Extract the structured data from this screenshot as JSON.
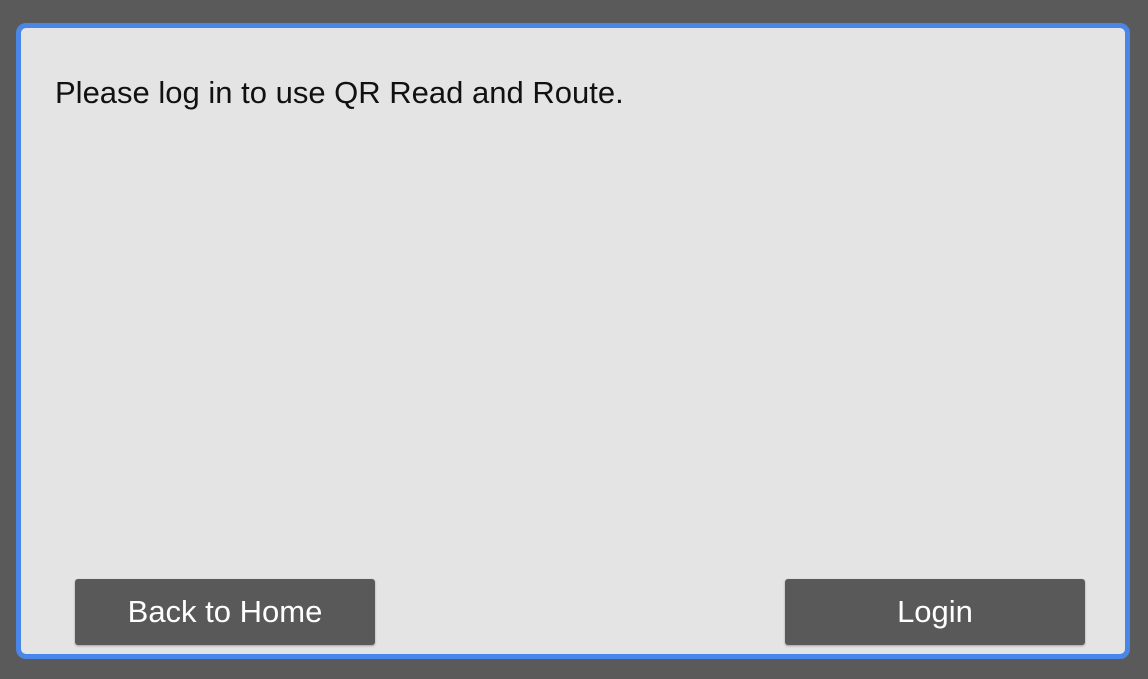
{
  "dialog": {
    "message": "Please log in to use QR Read and Route.",
    "back_label": "Back to Home",
    "login_label": "Login"
  },
  "colors": {
    "backdrop": "#5a5a5a",
    "dialog_bg": "#e4e4e4",
    "dialog_border": "#4a86e8",
    "button_bg": "#595959",
    "button_text": "#ffffff"
  }
}
